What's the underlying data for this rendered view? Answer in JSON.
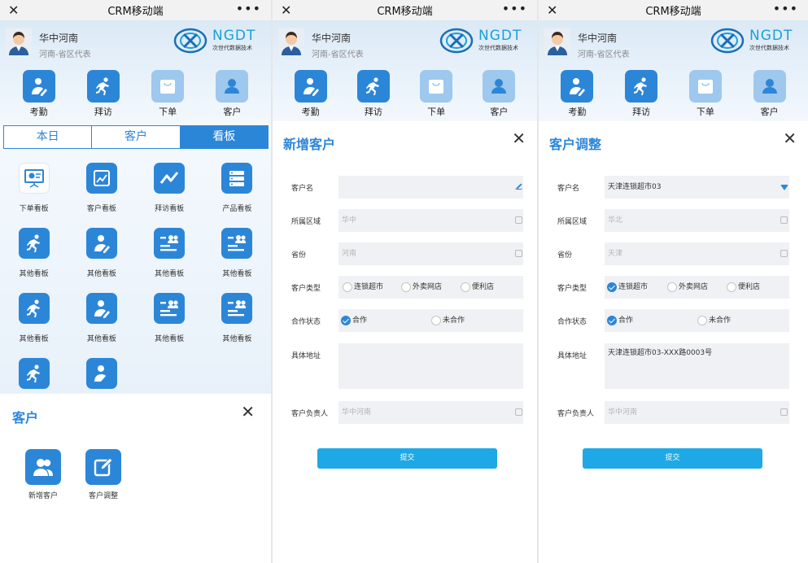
{
  "app": {
    "title": "CRM移动端",
    "close_glyph": "✕",
    "more_glyph": "•••"
  },
  "user": {
    "name": "华中河南",
    "role": "河南-省区代表"
  },
  "logo": {
    "text": "NGDT",
    "sub": "次世代数据技术"
  },
  "shortcuts": [
    {
      "label": "考勤",
      "icon": "attendance-icon"
    },
    {
      "label": "拜访",
      "icon": "runner-icon"
    },
    {
      "label": "下单",
      "icon": "shopping-bag-icon"
    },
    {
      "label": "客户",
      "icon": "person-icon"
    }
  ],
  "tabs": [
    {
      "label": "本日",
      "active": false
    },
    {
      "label": "客户",
      "active": false
    },
    {
      "label": "看板",
      "active": true
    }
  ],
  "boards": [
    {
      "label": "下单看板",
      "icon": "presentation-icon"
    },
    {
      "label": "客户看板",
      "icon": "chart-icon"
    },
    {
      "label": "拜访看板",
      "icon": "trend-icon"
    },
    {
      "label": "产品看板",
      "icon": "list-icon"
    },
    {
      "label": "其他看板",
      "icon": "runner-icon"
    },
    {
      "label": "其他看板",
      "icon": "person-edit-icon"
    },
    {
      "label": "其他看板",
      "icon": "id-card-icon"
    },
    {
      "label": "其他看板",
      "icon": "id-card-icon"
    },
    {
      "label": "其他看板",
      "icon": "runner-icon"
    },
    {
      "label": "其他看板",
      "icon": "person-edit-icon"
    },
    {
      "label": "其他看板",
      "icon": "id-card-icon"
    },
    {
      "label": "其他看板",
      "icon": "id-card-icon"
    }
  ],
  "customer_sheet": {
    "title": "客户",
    "close_glyph": "✕",
    "items": [
      {
        "label": "新增客户",
        "icon": "users-icon"
      },
      {
        "label": "客户调整",
        "icon": "edit-icon"
      }
    ]
  },
  "add_form": {
    "title": "新增客户",
    "close_glyph": "✕",
    "labels": {
      "name": "客户名",
      "region": "所属区域",
      "province": "省份",
      "type": "客户类型",
      "status": "合作状态",
      "address": "具体地址",
      "owner": "客户负责人"
    },
    "values": {
      "name": "",
      "region": "华中",
      "province": "河南",
      "address": "",
      "owner": "华中河南"
    },
    "type_options": [
      "连锁超市",
      "外卖网店",
      "便利店"
    ],
    "type_selected": "",
    "status_options": [
      "合作",
      "未合作"
    ],
    "status_selected": "合作",
    "submit": "提交"
  },
  "edit_form": {
    "title": "客户调整",
    "close_glyph": "✕",
    "labels": {
      "name": "客户名",
      "region": "所属区域",
      "province": "省份",
      "type": "客户类型",
      "status": "合作状态",
      "address": "具体地址",
      "owner": "客户负责人"
    },
    "values": {
      "name": "天津连锁超市03",
      "region": "华北",
      "province": "天津",
      "address": "天津连锁超市03-XXX路0003号",
      "owner": "华中河南"
    },
    "type_options": [
      "连锁超市",
      "外卖网店",
      "便利店"
    ],
    "type_selected": "连锁超市",
    "status_options": [
      "合作",
      "未合作"
    ],
    "status_selected": "合作",
    "submit": "提交"
  },
  "colors": {
    "accent": "#2c86d8",
    "submit": "#1ea8e6",
    "logo": "#1aa0d6"
  }
}
